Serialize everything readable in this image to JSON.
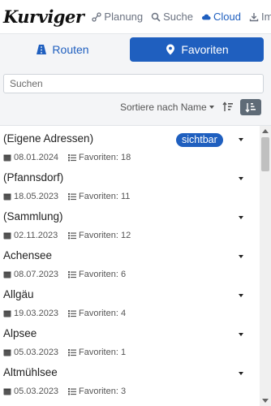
{
  "app": {
    "logo_text": "Kurviger"
  },
  "nav": {
    "items": [
      {
        "label": "Planung",
        "icon": "route-icon",
        "active": false
      },
      {
        "label": "Suche",
        "icon": "search-icon",
        "active": false
      },
      {
        "label": "Cloud",
        "icon": "cloud-icon",
        "active": true
      },
      {
        "label": "Imp",
        "icon": "import-icon",
        "active": false
      }
    ]
  },
  "tabs": {
    "routes": "Routen",
    "favorites": "Favoriten"
  },
  "search": {
    "placeholder": "Suchen",
    "value": ""
  },
  "sort": {
    "label": "Sortiere nach Name"
  },
  "favorites": [
    {
      "name": "(Eigene Adressen)",
      "date": "08.01.2024",
      "favs": "Favoriten: 18",
      "badge": "sichtbar"
    },
    {
      "name": "(Pfannsdorf)",
      "date": "18.05.2023",
      "favs": "Favoriten: 11"
    },
    {
      "name": "(Sammlung)",
      "date": "02.11.2023",
      "favs": "Favoriten: 12"
    },
    {
      "name": "Achensee",
      "date": "08.07.2023",
      "favs": "Favoriten: 6"
    },
    {
      "name": "Allgäu",
      "date": "19.03.2023",
      "favs": "Favoriten: 4"
    },
    {
      "name": "Alpsee",
      "date": "05.03.2023",
      "favs": "Favoriten: 1"
    },
    {
      "name": "Altmühlsee",
      "date": "05.03.2023",
      "favs": "Favoriten: 3"
    }
  ],
  "colors": {
    "accent": "#1f5fbf",
    "panel_bg": "#f4f5f7",
    "sort_button_active": "#5f6b77"
  }
}
